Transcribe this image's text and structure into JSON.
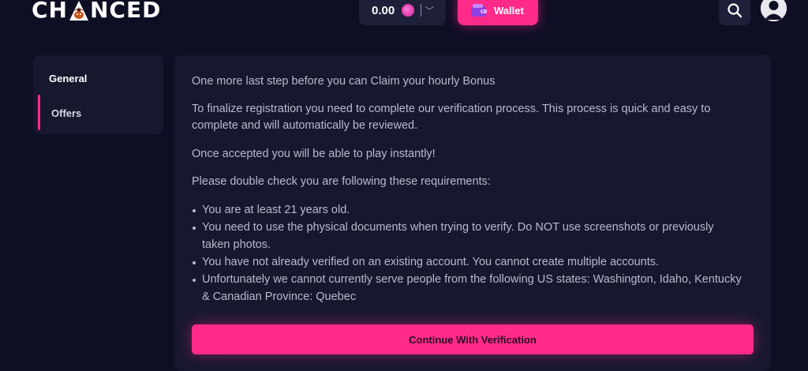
{
  "header": {
    "logo_text_start": "CH",
    "logo_text_end": "NCED",
    "balance": "0.00",
    "balance_chevron": "﹀",
    "wallet_label": "Wallet"
  },
  "icons": {
    "coin": "coin-icon",
    "wallet": "wallet-icon",
    "search": "search-icon",
    "user": "user-icon"
  },
  "sidebar": {
    "items": [
      {
        "label": "General",
        "active": false
      },
      {
        "label": "Offers",
        "active": true
      }
    ]
  },
  "main": {
    "intro": "One more last step before you can Claim your hourly Bonus",
    "finalize": "To finalize registration you need to complete our verification process. This process is quick and easy to complete and will automatically be reviewed.",
    "accepted": "Once accepted you will be able to play instantly!",
    "check": "Please double check you are following these requirements:",
    "requirements": [
      "You are at least 21 years old.",
      "You need to use the physical documents when trying to verify. Do NOT use screenshots or previously taken photos.",
      "You have not already verified on an existing account. You cannot create multiple accounts.",
      "Unfortunately we cannot currently serve people from the following US states: Washington, Idaho, Kentucky & Canadian Province: Quebec"
    ],
    "cta_label": "Continue With Verification"
  },
  "colors": {
    "background": "#0f0f24",
    "panel": "#17182e",
    "accent": "#ff2a8a",
    "text": "#b9bacb"
  }
}
